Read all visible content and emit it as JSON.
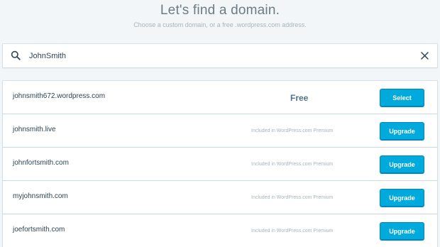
{
  "header": {
    "title": "Let's find a domain.",
    "subtitle": "Choose a custom domain, or a free .wordpress.com address."
  },
  "search": {
    "value": "JohnSmith",
    "icon": "search-icon",
    "clear_icon": "close-icon"
  },
  "results": [
    {
      "domain": "johnsmith672.wordpress.com",
      "price": "Free",
      "action": "Select"
    },
    {
      "domain": "johnsmith.live",
      "price": "Included in WordPress.com Premium",
      "action": "Upgrade"
    },
    {
      "domain": "johnfortsmith.com",
      "price": "Included in WordPress.com Premium",
      "action": "Upgrade"
    },
    {
      "domain": "myjohnsmith.com",
      "price": "Included in WordPress.com Premium",
      "action": "Upgrade"
    },
    {
      "domain": "joefortsmith.com",
      "price": "Included in WordPress.com Premium",
      "action": "Upgrade"
    }
  ],
  "colors": {
    "background": "#f3f6f8",
    "button": "#00aadc",
    "button_border": "#0087be",
    "free_text": "#4f748e"
  }
}
